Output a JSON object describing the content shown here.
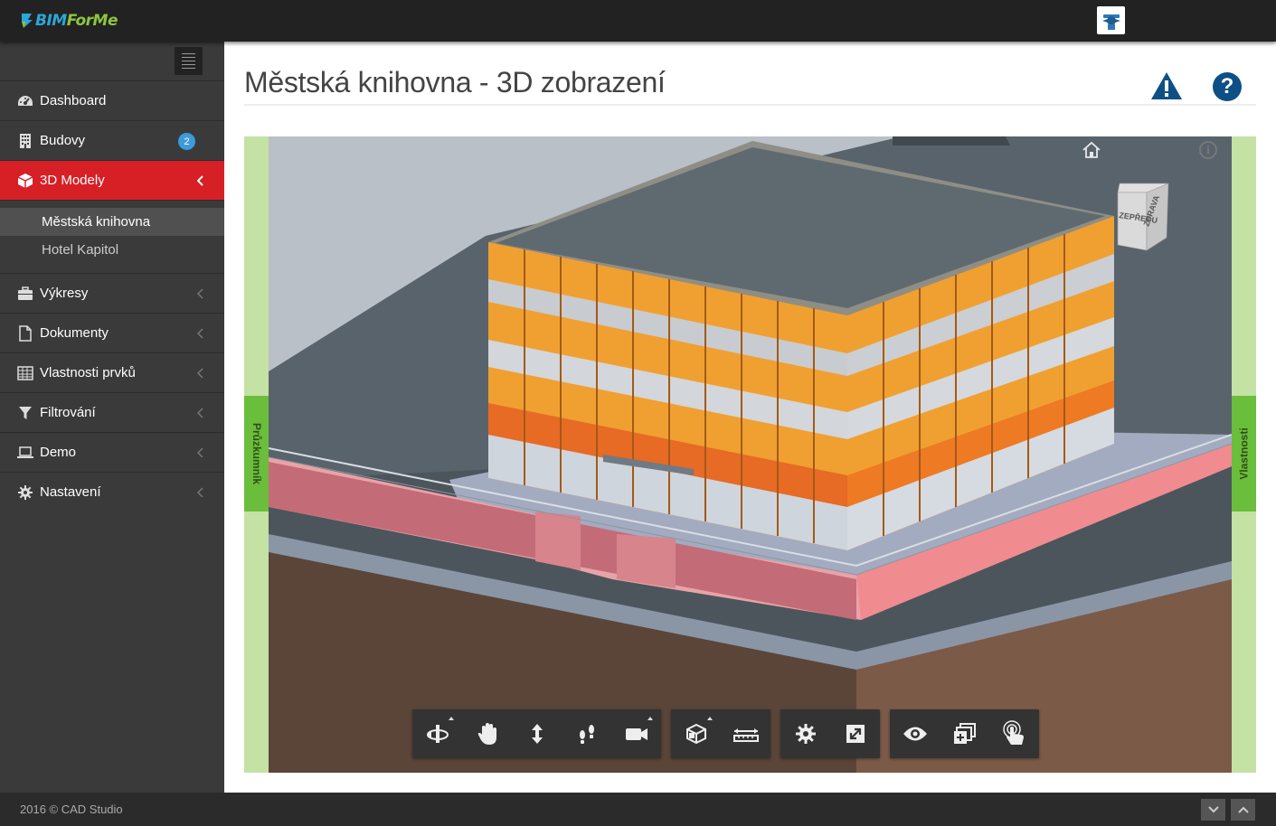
{
  "app": {
    "logo_text_a": "BIM",
    "logo_text_b": "ForMe"
  },
  "sidebar": {
    "items": [
      {
        "label": "Dashboard",
        "icon": "dashboard-icon"
      },
      {
        "label": "Budovy",
        "icon": "building-icon",
        "badge": "2"
      },
      {
        "label": "3D Modely",
        "icon": "cube-icon",
        "active": true
      },
      {
        "label": "Výkresy",
        "icon": "briefcase-icon"
      },
      {
        "label": "Dokumenty",
        "icon": "document-icon"
      },
      {
        "label": "Vlastnosti prvků",
        "icon": "table-icon"
      },
      {
        "label": "Filtrování",
        "icon": "filter-icon"
      },
      {
        "label": "Demo",
        "icon": "laptop-icon"
      },
      {
        "label": "Nastavení",
        "icon": "gear-icon"
      }
    ],
    "subitems": [
      {
        "label": "Městská knihovna",
        "current": true
      },
      {
        "label": "Hotel Kapitol"
      }
    ]
  },
  "main": {
    "title": "Městská knihovna - 3D zobrazení"
  },
  "viewer": {
    "left_panel": "Průzkumník",
    "right_panel": "Vlastnosti",
    "viewcube_front": "ZEPŘEDU",
    "viewcube_right": "ZPRAVA",
    "info_glyph": "i",
    "toolbar": [
      {
        "name": "orbit-icon",
        "caret": true
      },
      {
        "name": "pan-icon"
      },
      {
        "name": "zoom-icon"
      },
      {
        "name": "walk-icon"
      },
      {
        "name": "camera-icon",
        "caret": true
      },
      {
        "name": "explode-icon",
        "caret": true
      },
      {
        "name": "measure-icon"
      },
      {
        "name": "settings-icon"
      },
      {
        "name": "fullscreen-icon"
      },
      {
        "name": "visibility-icon"
      },
      {
        "name": "model-browser-icon"
      },
      {
        "name": "properties-touch-icon"
      }
    ]
  },
  "footer": {
    "text": "2016 © CAD Studio"
  },
  "colors": {
    "topbar": "#222222",
    "sidebar": "#3a3a3a",
    "active": "#d71f26",
    "badge": "#3c9bdc",
    "panel_green": "#6bbd3c",
    "panel_light": "#c4e2a4"
  }
}
